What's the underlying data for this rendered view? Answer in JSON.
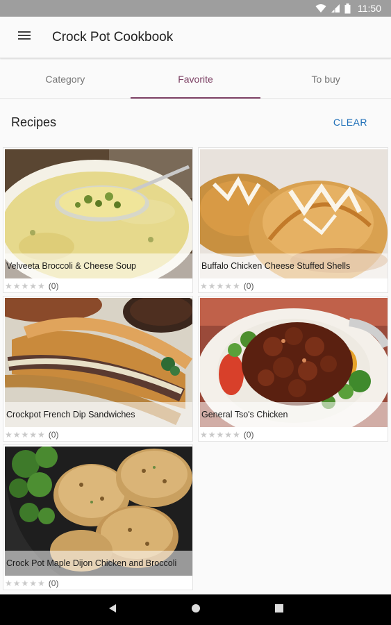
{
  "status_bar": {
    "time": "11:50",
    "icons": [
      "wifi-icon",
      "signal-icon",
      "battery-icon"
    ]
  },
  "app_bar": {
    "title": "Crock Pot Cookbook",
    "menu_icon": "hamburger-menu-icon"
  },
  "tabs": [
    {
      "label": "Category",
      "active": false
    },
    {
      "label": "Favorite",
      "active": true
    },
    {
      "label": "To buy",
      "active": false
    }
  ],
  "section": {
    "title": "Recipes",
    "clear_label": "CLEAR"
  },
  "recipes": [
    {
      "title": "Velveeta Broccoli & Cheese Soup",
      "rating": 0,
      "count": "(0)",
      "stars": "★★★★★"
    },
    {
      "title": "Buffalo Chicken Cheese Stuffed Shells",
      "rating": 0,
      "count": "(0)",
      "stars": "★★★★★"
    },
    {
      "title": "Crockpot French Dip Sandwiches",
      "rating": 0,
      "count": "(0)",
      "stars": "★★★★★"
    },
    {
      "title": "General Tso's Chicken",
      "rating": 0,
      "count": "(0)",
      "stars": "★★★★★"
    },
    {
      "title": "Crock Pot Maple Dijon Chicken and Broccoli",
      "rating": 0,
      "count": "(0)",
      "stars": "★★★★★"
    }
  ],
  "nav_bar": {
    "icons": [
      "back-icon",
      "home-icon",
      "recents-icon"
    ]
  },
  "colors": {
    "accent": "#7b3f63",
    "link": "#1e6fb8",
    "status_bar": "#9e9e9e",
    "nav_bar": "#000000"
  }
}
